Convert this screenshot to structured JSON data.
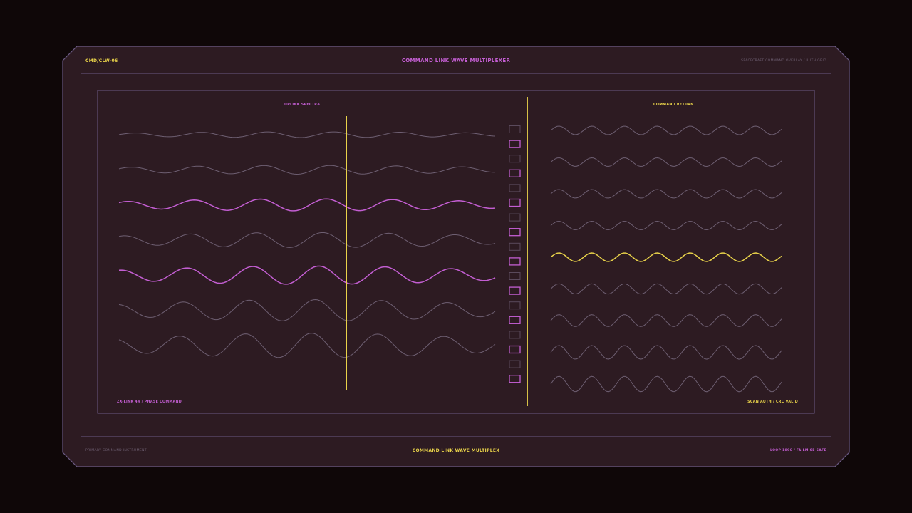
{
  "header": {
    "code": "CMD/CLW-06",
    "title": "COMMAND LINK WAVE MULTIPLEXER",
    "subtitle": "SPACECRAFT COMMAND OVERLAY / RUTH GRID"
  },
  "footer": {
    "left": "PRIMARY COMMAND INSTRUMENT",
    "center": "COMMAND LINK WAVE MULTIPLEX",
    "right": "LOOP 1896 / FAILMISE SAFE"
  },
  "panels": {
    "uplink": {
      "title": "UPLINK SPECTRA",
      "footer": "ZX-LINK 44 / PHASE COMMAND",
      "highlighted_waves": [
        3,
        5
      ],
      "wave_count": 7
    },
    "return": {
      "title": "COMMAND RETURN",
      "footer": "SCAN AUTH / CRC VALID",
      "highlighted_waves": [
        5
      ],
      "wave_count": 9
    },
    "channels": {
      "count": 18,
      "active": [
        2,
        4,
        6,
        8,
        10,
        12,
        14,
        16,
        18
      ]
    }
  },
  "colors": {
    "background": "#0f0708",
    "frame": "#2d1b22",
    "frame_border": "#6b5a84",
    "accent_magenta": "#c35ed2",
    "accent_yellow": "#e9d34a",
    "muted_wave": "#6e5f72",
    "muted_cell": "#5a4a5c"
  }
}
